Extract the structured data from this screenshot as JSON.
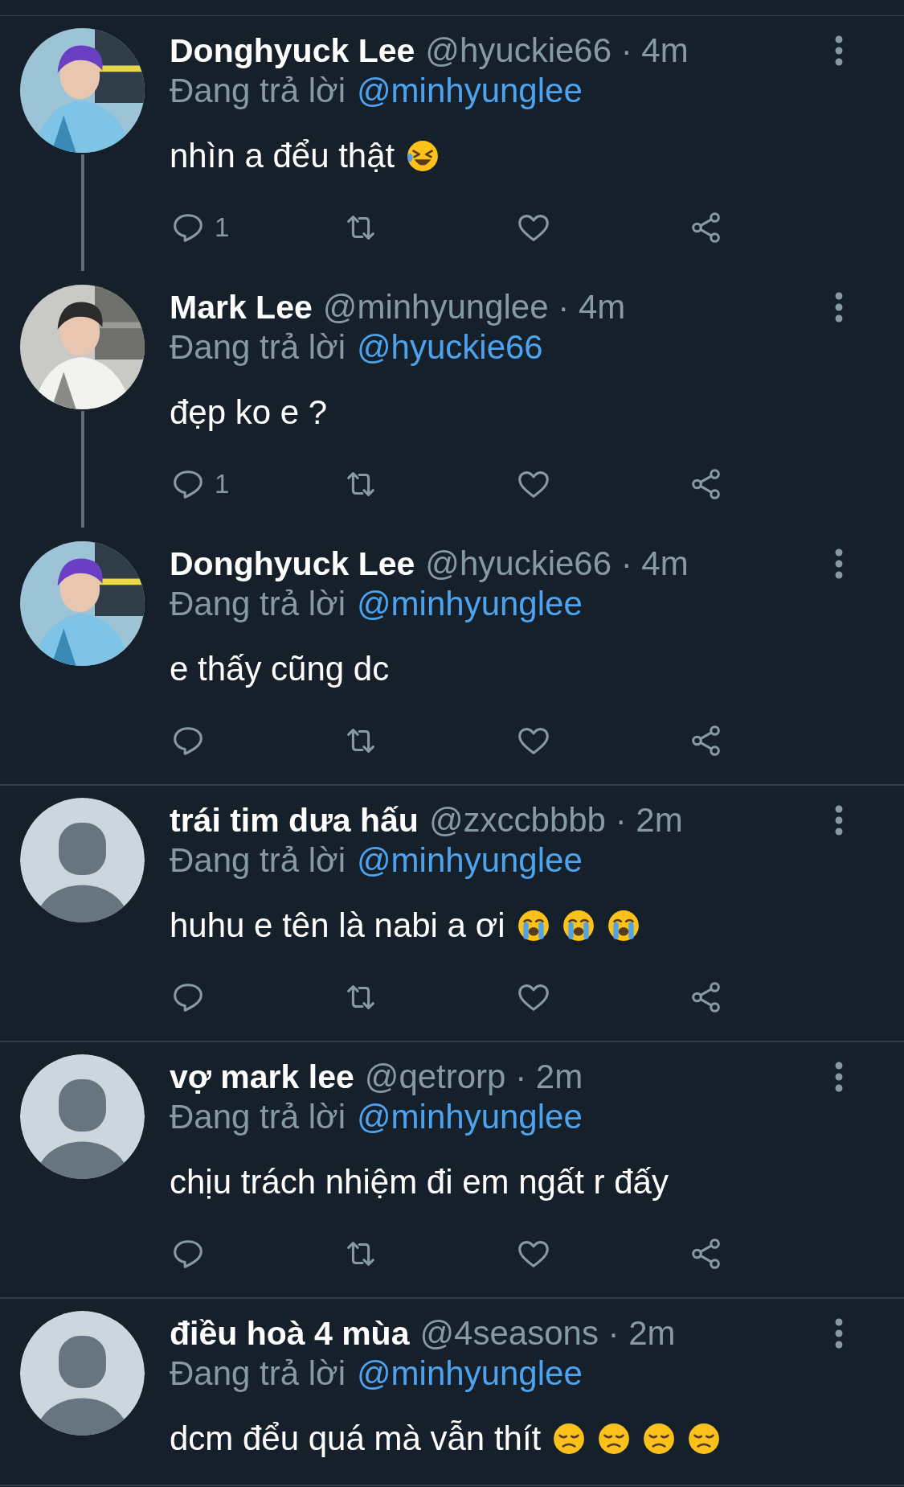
{
  "tweets": [
    {
      "name": "Donghyuck Lee",
      "handle": "@hyuckie66",
      "time": "· 4m",
      "reply_label": "Đang trả lời",
      "reply_to": "@minhyunglee",
      "text": "nhìn a đểu thật",
      "emojis": [
        {
          "kind": "rolling-laughing"
        }
      ],
      "connected_to_next": true,
      "actions_shown": true,
      "reply_count": "1"
    },
    {
      "name": "Mark Lee",
      "handle": "@minhyunglee",
      "time": "· 4m",
      "reply_label": "Đang trả lời",
      "reply_to": "@hyuckie66",
      "text": "đẹp ko e ?",
      "connected_to_next": true,
      "actions_shown": true,
      "reply_count": "1"
    },
    {
      "name": "Donghyuck Lee",
      "handle": "@hyuckie66",
      "time": "· 4m",
      "reply_label": "Đang trả lời",
      "reply_to": "@minhyunglee",
      "text": "e thấy cũng dc",
      "connected_to_next": false,
      "actions_shown": true
    },
    {
      "name": "trái tim dưa hấu",
      "handle": "@zxccbbbb",
      "time": "· 2m",
      "reply_label": "Đang trả lời",
      "reply_to": "@minhyunglee",
      "text": "huhu e tên là nabi a ơi",
      "emojis": [
        {
          "kind": "crying"
        },
        {
          "kind": "crying"
        },
        {
          "kind": "crying"
        }
      ],
      "avatar": {
        "kind": "default"
      },
      "connected_to_next": false,
      "actions_shown": true
    },
    {
      "name": "vợ mark lee",
      "handle": "@qetrorp",
      "time": "· 2m",
      "reply_label": "Đang trả lời",
      "reply_to": "@minhyunglee",
      "text": "chịu trách nhiệm đi em ngất r đấy",
      "avatar": {
        "kind": "default"
      },
      "connected_to_next": false,
      "actions_shown": true
    },
    {
      "name": "điều hoà 4 mùa",
      "handle": "@4seasons",
      "time": "· 2m",
      "reply_label": "Đang trả lời",
      "reply_to": "@minhyunglee",
      "text": "dcm đểu quá mà vẫn thít",
      "emojis": [
        {
          "kind": "disappointed"
        },
        {
          "kind": "disappointed"
        },
        {
          "kind": "disappointed"
        },
        {
          "kind": "disappointed"
        }
      ],
      "avatar": {
        "kind": "default"
      },
      "connected_to_next": false,
      "actions_shown": false
    }
  ]
}
